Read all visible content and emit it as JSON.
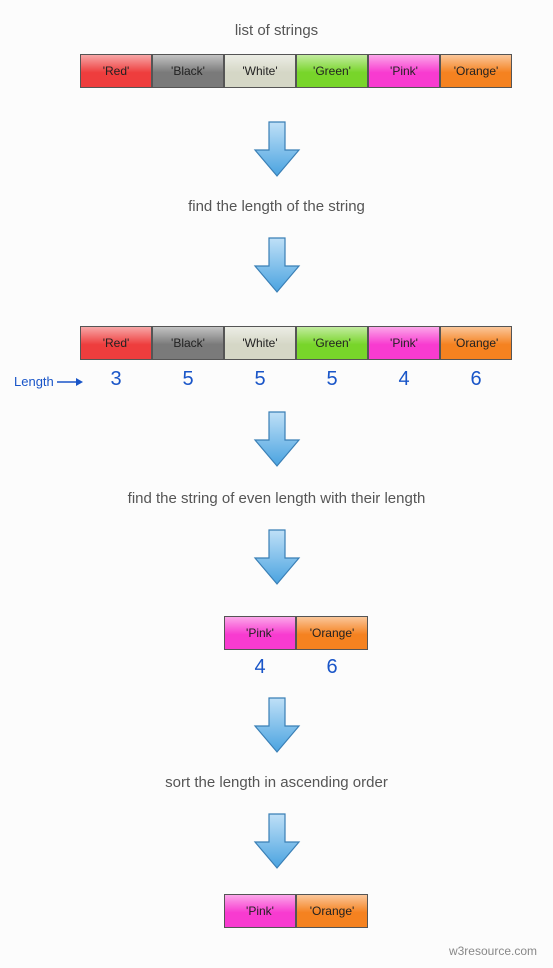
{
  "captions": {
    "c1": "list of strings",
    "c2": "find the length of the string",
    "c3": "find the string of even length with their length",
    "c4": "sort the length in ascending order"
  },
  "row1": {
    "cells": [
      {
        "label": "'Red'",
        "color": "#ee3d3d"
      },
      {
        "label": "'Black'",
        "color": "#7a7a7a"
      },
      {
        "label": "'White'",
        "color": "#d5d7c6"
      },
      {
        "label": "'Green'",
        "color": "#78d52a"
      },
      {
        "label": "'Pink'",
        "color": "#f83bd0"
      },
      {
        "label": "'Orange'",
        "color": "#f58220"
      }
    ]
  },
  "row2": {
    "cells": [
      {
        "label": "'Red'",
        "color": "#ee3d3d",
        "len": "3"
      },
      {
        "label": "'Black'",
        "color": "#7a7a7a",
        "len": "5"
      },
      {
        "label": "'White'",
        "color": "#d5d7c6",
        "len": "5"
      },
      {
        "label": "'Green'",
        "color": "#78d52a",
        "len": "5"
      },
      {
        "label": "'Pink'",
        "color": "#f83bd0",
        "len": "4"
      },
      {
        "label": "'Orange'",
        "color": "#f58220",
        "len": "6"
      }
    ],
    "length_label": "Length"
  },
  "row3": {
    "cells": [
      {
        "label": "'Pink'",
        "color": "#f83bd0",
        "len": "4"
      },
      {
        "label": "'Orange'",
        "color": "#f58220",
        "len": "6"
      }
    ]
  },
  "row4": {
    "cells": [
      {
        "label": "'Pink'",
        "color": "#f83bd0"
      },
      {
        "label": "'Orange'",
        "color": "#f58220"
      }
    ]
  },
  "watermark": "w3resource.com",
  "chart_data": {
    "type": "table",
    "title": "String list filtering and sorting by even length",
    "steps": [
      {
        "step": "list of strings",
        "items": [
          "Red",
          "Black",
          "White",
          "Green",
          "Pink",
          "Orange"
        ]
      },
      {
        "step": "find the length of the string",
        "items": [
          "Red",
          "Black",
          "White",
          "Green",
          "Pink",
          "Orange"
        ],
        "lengths": [
          3,
          5,
          5,
          5,
          4,
          6
        ]
      },
      {
        "step": "find the string of even length with their length",
        "items": [
          "Pink",
          "Orange"
        ],
        "lengths": [
          4,
          6
        ]
      },
      {
        "step": "sort the length in ascending order",
        "items": [
          "Pink",
          "Orange"
        ]
      }
    ]
  }
}
